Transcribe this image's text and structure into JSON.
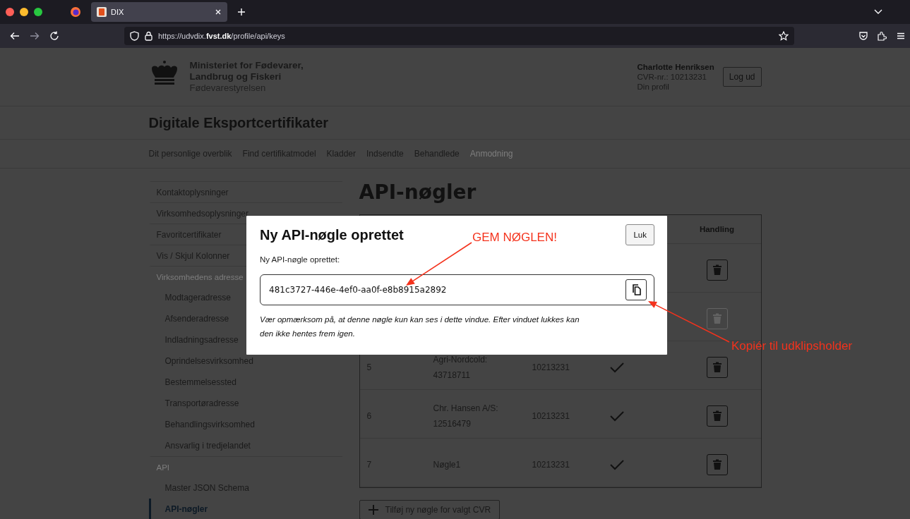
{
  "browser": {
    "tab_title": "DIX",
    "url": "https://udvdix.**fvst.dk**/profile/api/keys"
  },
  "header": {
    "ministry_line_1": "Ministeriet for Fødevarer,",
    "ministry_line_2": "Landbrug og Fiskeri",
    "agency": "Fødevarestyrelsen",
    "user_name": "Charlotte Henriksen",
    "cvr": "CVR-nr.: 10213231",
    "profile_link": "Din profil",
    "logout_button": "Log ud"
  },
  "site_title": "Digitale Eksportcertifikater",
  "nav": [
    {
      "label": "Dit personlige overblik",
      "disabled": false
    },
    {
      "label": "Find certifikatmodel",
      "disabled": false
    },
    {
      "label": "Kladder",
      "disabled": false
    },
    {
      "label": "Indsendte",
      "disabled": false
    },
    {
      "label": "Behandlede",
      "disabled": false
    },
    {
      "label": "Anmodning",
      "disabled": true
    }
  ],
  "sidebar": {
    "items": [
      {
        "label": "Kontaktoplysninger",
        "kind": "link",
        "selected": false
      },
      {
        "label": "Virksomhedsoplysninger",
        "kind": "link",
        "selected": false
      },
      {
        "label": "Favoritcertifikater",
        "kind": "link",
        "selected": false
      },
      {
        "label": "Vis / Skjul Kolonner",
        "kind": "link",
        "selected": false
      },
      {
        "label": "Virksomhedens adresse",
        "kind": "heading",
        "children": [
          {
            "label": "Modtageradresse",
            "kind": "link",
            "selected": false
          },
          {
            "label": "Afsenderadresse",
            "kind": "link",
            "selected": false
          },
          {
            "label": "Indladningsadresse",
            "kind": "link",
            "selected": false
          },
          {
            "label": "Oprindelsesvirksomhed",
            "kind": "link",
            "selected": false
          },
          {
            "label": "Bestemmelsessted",
            "kind": "link",
            "selected": false
          },
          {
            "label": "Transportøradresse",
            "kind": "link",
            "selected": false
          },
          {
            "label": "Behandlingsvirksomhed",
            "kind": "link",
            "selected": false
          },
          {
            "label": "Ansvarlig i tredjelandet",
            "kind": "link",
            "selected": false
          }
        ]
      },
      {
        "label": "API",
        "kind": "heading",
        "children": [
          {
            "label": "Master JSON Schema",
            "kind": "link",
            "selected": false
          },
          {
            "label": "API-nøgler",
            "kind": "link",
            "selected": true
          }
        ]
      }
    ]
  },
  "page_title": "API-nøgler",
  "table": {
    "handling_heading": "Handling",
    "rows": [
      {
        "delete_disabled": false
      },
      {
        "delete_disabled": true
      },
      {
        "number": "5",
        "name": "Agri-Nordcold: 43718711",
        "cvr": "10213231",
        "active": true,
        "delete_disabled": false
      },
      {
        "number": "6",
        "name": "Chr. Hansen A/S: 12516479",
        "cvr": "10213231",
        "active": true,
        "delete_disabled": false
      },
      {
        "number": "7",
        "name": "Nøgle1",
        "cvr": "10213231",
        "active": true,
        "delete_disabled": false
      }
    ]
  },
  "add_button": "Tilføj ny nøgle for valgt CVR",
  "modal": {
    "title": "Ny API-nøgle oprettet",
    "close_button": "Luk",
    "field_label": "Ny API-nøgle oprettet:",
    "key_value": "481c3727-446e-4ef0-aa0f-e8b8915a2892",
    "note": "Vær opmærksom på, at denne nøgle kun kan ses i dette vindue. Efter vinduet lukkes kan den ikke hentes frem igen."
  },
  "annotations": [
    {
      "text": "GEM NØGLEN!"
    },
    {
      "text": "Kopiér til udklipsholder"
    }
  ]
}
